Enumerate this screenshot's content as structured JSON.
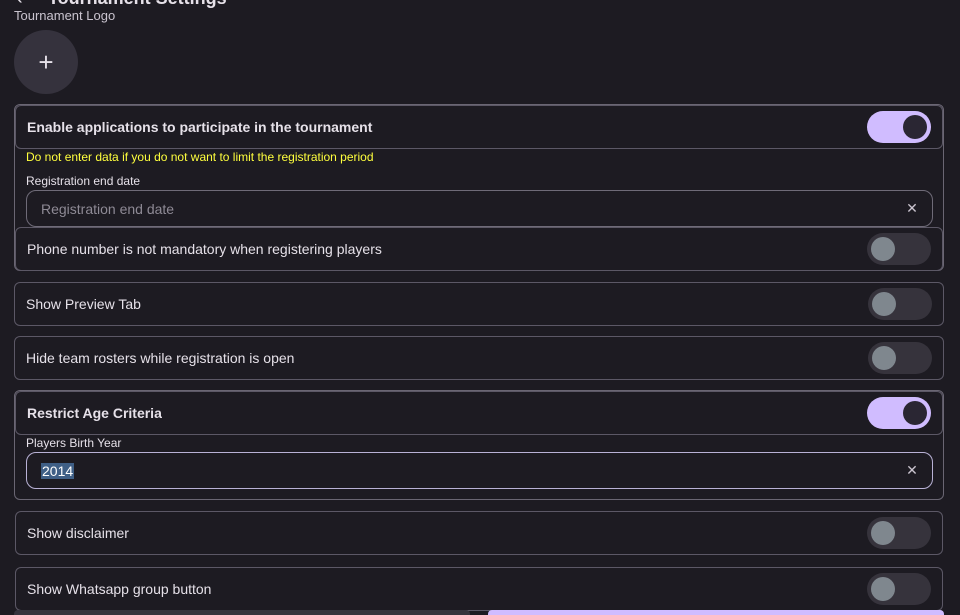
{
  "header": {
    "title": "Tournament Settings",
    "back_icon": "arrow-back-icon"
  },
  "logo": {
    "label": "Tournament Logo",
    "add_symbol": "+"
  },
  "registration": {
    "label": "Enable applications to participate in the tournament",
    "toggle_on": true,
    "hint": "Do not enter data if you do not want to limit the registration period",
    "end_date_label": "Registration end date",
    "end_date_placeholder": "Registration end date",
    "end_date_value": "",
    "phone_label": "Phone number is not mandatory when registering players",
    "phone_toggle_on": false
  },
  "preview": {
    "label": "Show Preview Tab",
    "toggle_on": false
  },
  "rosters": {
    "label": "Hide team rosters while registration is open",
    "toggle_on": false
  },
  "age": {
    "label": "Restrict Age Criteria",
    "toggle_on": true,
    "birth_year_label": "Players Birth Year",
    "birth_year_value": "2014"
  },
  "disclaimer": {
    "label": "Show disclaimer",
    "toggle_on": false
  },
  "whatsapp": {
    "label": "Show Whatsapp group button",
    "toggle_on": false
  },
  "colors": {
    "background": "#1d1b22",
    "accent": "#d0bcff",
    "hint": "#ffff3d",
    "toggle_off": "#36333c"
  }
}
